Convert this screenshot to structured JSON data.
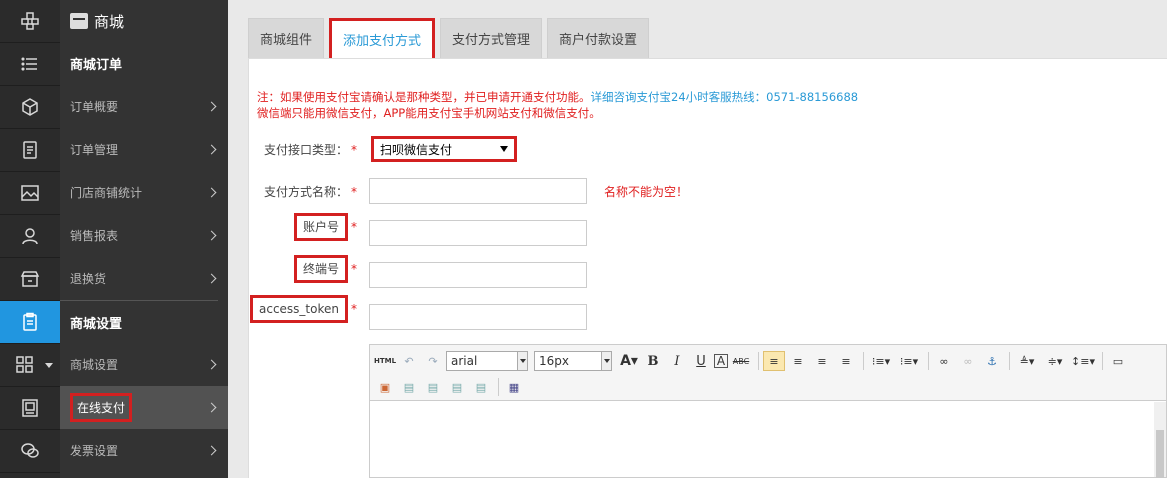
{
  "sidebar": {
    "section_title": "商城",
    "groups": [
      {
        "title": "商城订单",
        "items": [
          {
            "label": "订单概要"
          },
          {
            "label": "订单管理"
          },
          {
            "label": "门店商铺统计"
          },
          {
            "label": "销售报表"
          },
          {
            "label": "退换货"
          }
        ]
      },
      {
        "title": "商城设置",
        "items": [
          {
            "label": "商城设置"
          },
          {
            "label": "在线支付"
          },
          {
            "label": "发票设置"
          }
        ]
      }
    ]
  },
  "tabs": [
    {
      "label": "商城组件"
    },
    {
      "label": "添加支付方式"
    },
    {
      "label": "支付方式管理"
    },
    {
      "label": "商户付款设置"
    }
  ],
  "notice": {
    "line1_red": "注：如果使用支付宝请确认是那种类型，并已申请开通支付功能。",
    "line1_blue": "详细咨询支付宝24小时客服热线：0571-88156688",
    "line2_red": "微信端只能用微信支付，APP能用支付宝手机网站支付和微信支付。"
  },
  "form": {
    "type_label": "支付接口类型：",
    "type_value": "扫呗微信支付",
    "name_label": "支付方式名称：",
    "name_error": "名称不能为空！",
    "account_label": "账户号",
    "terminal_label": "终端号",
    "token_label": "access_token",
    "required_mark": "*"
  },
  "editor": {
    "font_family": "arial",
    "font_size": "16px",
    "html_label": "HTML"
  },
  "colors": {
    "accent": "#2196e0",
    "highlight": "#d32020"
  }
}
